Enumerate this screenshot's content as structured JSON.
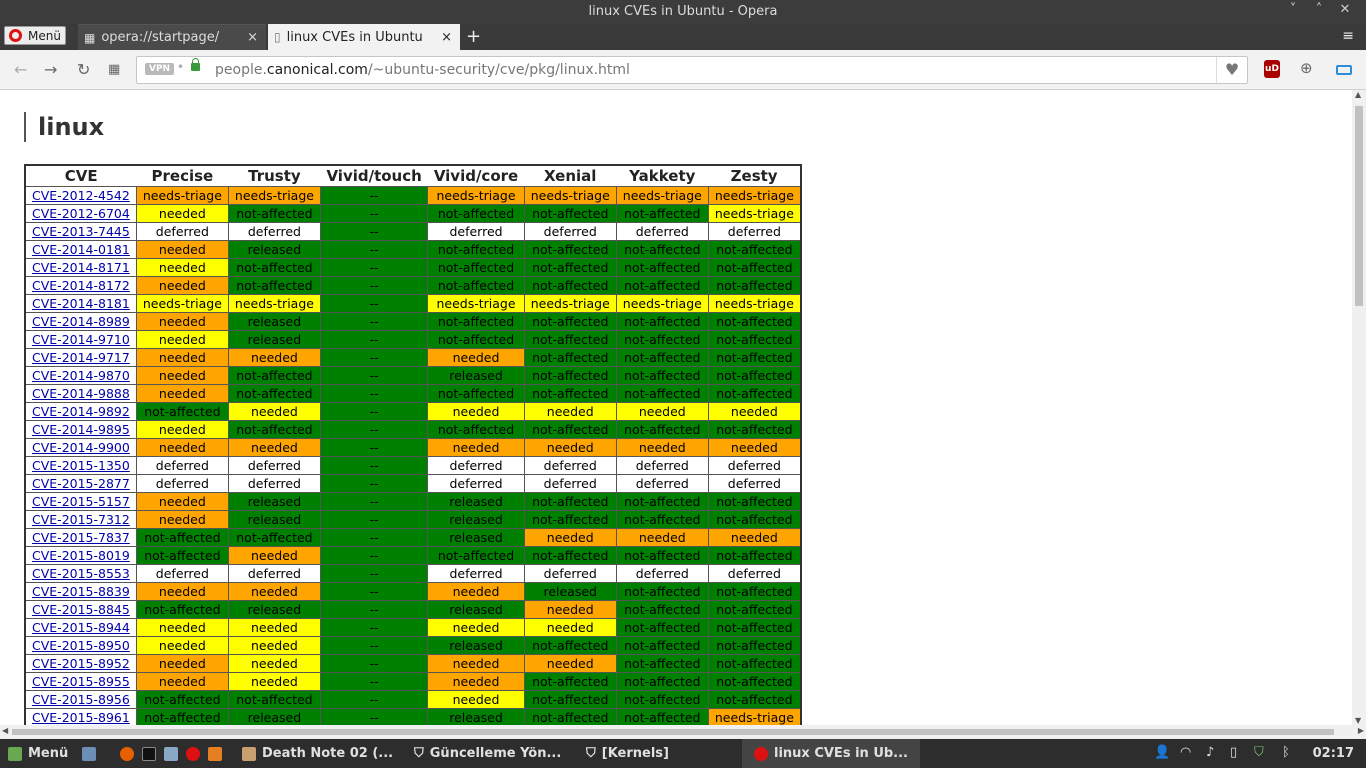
{
  "window": {
    "title": "linux CVEs in Ubuntu - Opera"
  },
  "browser": {
    "menu_label": "Menü",
    "tabs": [
      {
        "label": "opera://startpage/",
        "close": "×"
      },
      {
        "label": "linux CVEs in Ubuntu",
        "close": "×"
      }
    ],
    "newtab": "+",
    "vpn_label": "VPN",
    "url_prefix": "people.",
    "url_domain": "canonical.com",
    "url_path": "/~ubuntu-security/cve/pkg/linux.html"
  },
  "page": {
    "heading": "linux",
    "columns": [
      "CVE",
      "Precise",
      "Trusty",
      "Vivid/touch",
      "Vivid/core",
      "Xenial",
      "Yakkety",
      "Zesty"
    ],
    "rows": [
      [
        "CVE-2012-4542",
        "needs-triage",
        "needs-triage",
        "--",
        "needs-triage",
        "needs-triage",
        "needs-triage",
        "needs-triage"
      ],
      [
        "CVE-2012-6704",
        "needed",
        "not-affected",
        "--",
        "not-affected",
        "not-affected",
        "not-affected",
        "needs-triage"
      ],
      [
        "CVE-2013-7445",
        "deferred",
        "deferred",
        "--",
        "deferred",
        "deferred",
        "deferred",
        "deferred"
      ],
      [
        "CVE-2014-0181",
        "needed",
        "released",
        "--",
        "not-affected",
        "not-affected",
        "not-affected",
        "not-affected"
      ],
      [
        "CVE-2014-8171",
        "needed",
        "not-affected",
        "--",
        "not-affected",
        "not-affected",
        "not-affected",
        "not-affected"
      ],
      [
        "CVE-2014-8172",
        "needed",
        "not-affected",
        "--",
        "not-affected",
        "not-affected",
        "not-affected",
        "not-affected"
      ],
      [
        "CVE-2014-8181",
        "needs-triage",
        "needs-triage",
        "--",
        "needs-triage",
        "needs-triage",
        "needs-triage",
        "needs-triage"
      ],
      [
        "CVE-2014-8989",
        "needed",
        "released",
        "--",
        "not-affected",
        "not-affected",
        "not-affected",
        "not-affected"
      ],
      [
        "CVE-2014-9710",
        "needed",
        "released",
        "--",
        "not-affected",
        "not-affected",
        "not-affected",
        "not-affected"
      ],
      [
        "CVE-2014-9717",
        "needed",
        "needed",
        "--",
        "needed",
        "not-affected",
        "not-affected",
        "not-affected"
      ],
      [
        "CVE-2014-9870",
        "needed",
        "not-affected",
        "--",
        "released",
        "not-affected",
        "not-affected",
        "not-affected"
      ],
      [
        "CVE-2014-9888",
        "needed",
        "not-affected",
        "--",
        "not-affected",
        "not-affected",
        "not-affected",
        "not-affected"
      ],
      [
        "CVE-2014-9892",
        "not-affected",
        "needed",
        "--",
        "needed",
        "needed",
        "needed",
        "needed"
      ],
      [
        "CVE-2014-9895",
        "needed",
        "not-affected",
        "--",
        "not-affected",
        "not-affected",
        "not-affected",
        "not-affected"
      ],
      [
        "CVE-2014-9900",
        "needed",
        "needed",
        "--",
        "needed",
        "needed",
        "needed",
        "needed"
      ],
      [
        "CVE-2015-1350",
        "deferred",
        "deferred",
        "--",
        "deferred",
        "deferred",
        "deferred",
        "deferred"
      ],
      [
        "CVE-2015-2877",
        "deferred",
        "deferred",
        "--",
        "deferred",
        "deferred",
        "deferred",
        "deferred"
      ],
      [
        "CVE-2015-5157",
        "needed",
        "released",
        "--",
        "released",
        "not-affected",
        "not-affected",
        "not-affected"
      ],
      [
        "CVE-2015-7312",
        "needed",
        "released",
        "--",
        "released",
        "not-affected",
        "not-affected",
        "not-affected"
      ],
      [
        "CVE-2015-7837",
        "not-affected",
        "not-affected",
        "--",
        "released",
        "needed",
        "needed",
        "needed"
      ],
      [
        "CVE-2015-8019",
        "not-affected",
        "needed",
        "--",
        "not-affected",
        "not-affected",
        "not-affected",
        "not-affected"
      ],
      [
        "CVE-2015-8553",
        "deferred",
        "deferred",
        "--",
        "deferred",
        "deferred",
        "deferred",
        "deferred"
      ],
      [
        "CVE-2015-8839",
        "needed",
        "needed",
        "--",
        "needed",
        "released",
        "not-affected",
        "not-affected"
      ],
      [
        "CVE-2015-8845",
        "not-affected",
        "released",
        "--",
        "released",
        "needed",
        "not-affected",
        "not-affected"
      ],
      [
        "CVE-2015-8944",
        "needed",
        "needed",
        "--",
        "needed",
        "needed",
        "not-affected",
        "not-affected"
      ],
      [
        "CVE-2015-8950",
        "needed",
        "needed",
        "--",
        "released",
        "not-affected",
        "not-affected",
        "not-affected"
      ],
      [
        "CVE-2015-8952",
        "needed",
        "needed",
        "--",
        "needed",
        "needed",
        "not-affected",
        "not-affected"
      ],
      [
        "CVE-2015-8955",
        "needed",
        "needed",
        "--",
        "needed",
        "not-affected",
        "not-affected",
        "not-affected"
      ],
      [
        "CVE-2015-8956",
        "not-affected",
        "not-affected",
        "--",
        "needed",
        "not-affected",
        "not-affected",
        "not-affected"
      ],
      [
        "CVE-2015-8961",
        "not-affected",
        "released",
        "--",
        "released",
        "not-affected",
        "not-affected",
        "needs-triage"
      ]
    ],
    "yellow_cells": [
      [
        1,
        1
      ],
      [
        1,
        7
      ],
      [
        4,
        1
      ],
      [
        6,
        1
      ],
      [
        6,
        2
      ],
      [
        6,
        4
      ],
      [
        6,
        5
      ],
      [
        6,
        6
      ],
      [
        6,
        7
      ],
      [
        8,
        1
      ],
      [
        12,
        2
      ],
      [
        12,
        4
      ],
      [
        12,
        5
      ],
      [
        12,
        6
      ],
      [
        12,
        7
      ],
      [
        13,
        1
      ],
      [
        24,
        1
      ],
      [
        24,
        2
      ],
      [
        24,
        4
      ],
      [
        24,
        5
      ],
      [
        25,
        1
      ],
      [
        25,
        2
      ],
      [
        26,
        2
      ],
      [
        27,
        2
      ],
      [
        28,
        4
      ]
    ]
  },
  "taskbar": {
    "start_label": "Menü",
    "tasks": [
      "Death Note 02 (...",
      "Güncelleme Yön...",
      "[Kernels]",
      "linux CVEs in Ub..."
    ],
    "clock": "02:17"
  },
  "colors": {
    "orange": "#ffa500",
    "yellow": "#ffff00",
    "green": "#008000",
    "link": "#0000aa"
  }
}
